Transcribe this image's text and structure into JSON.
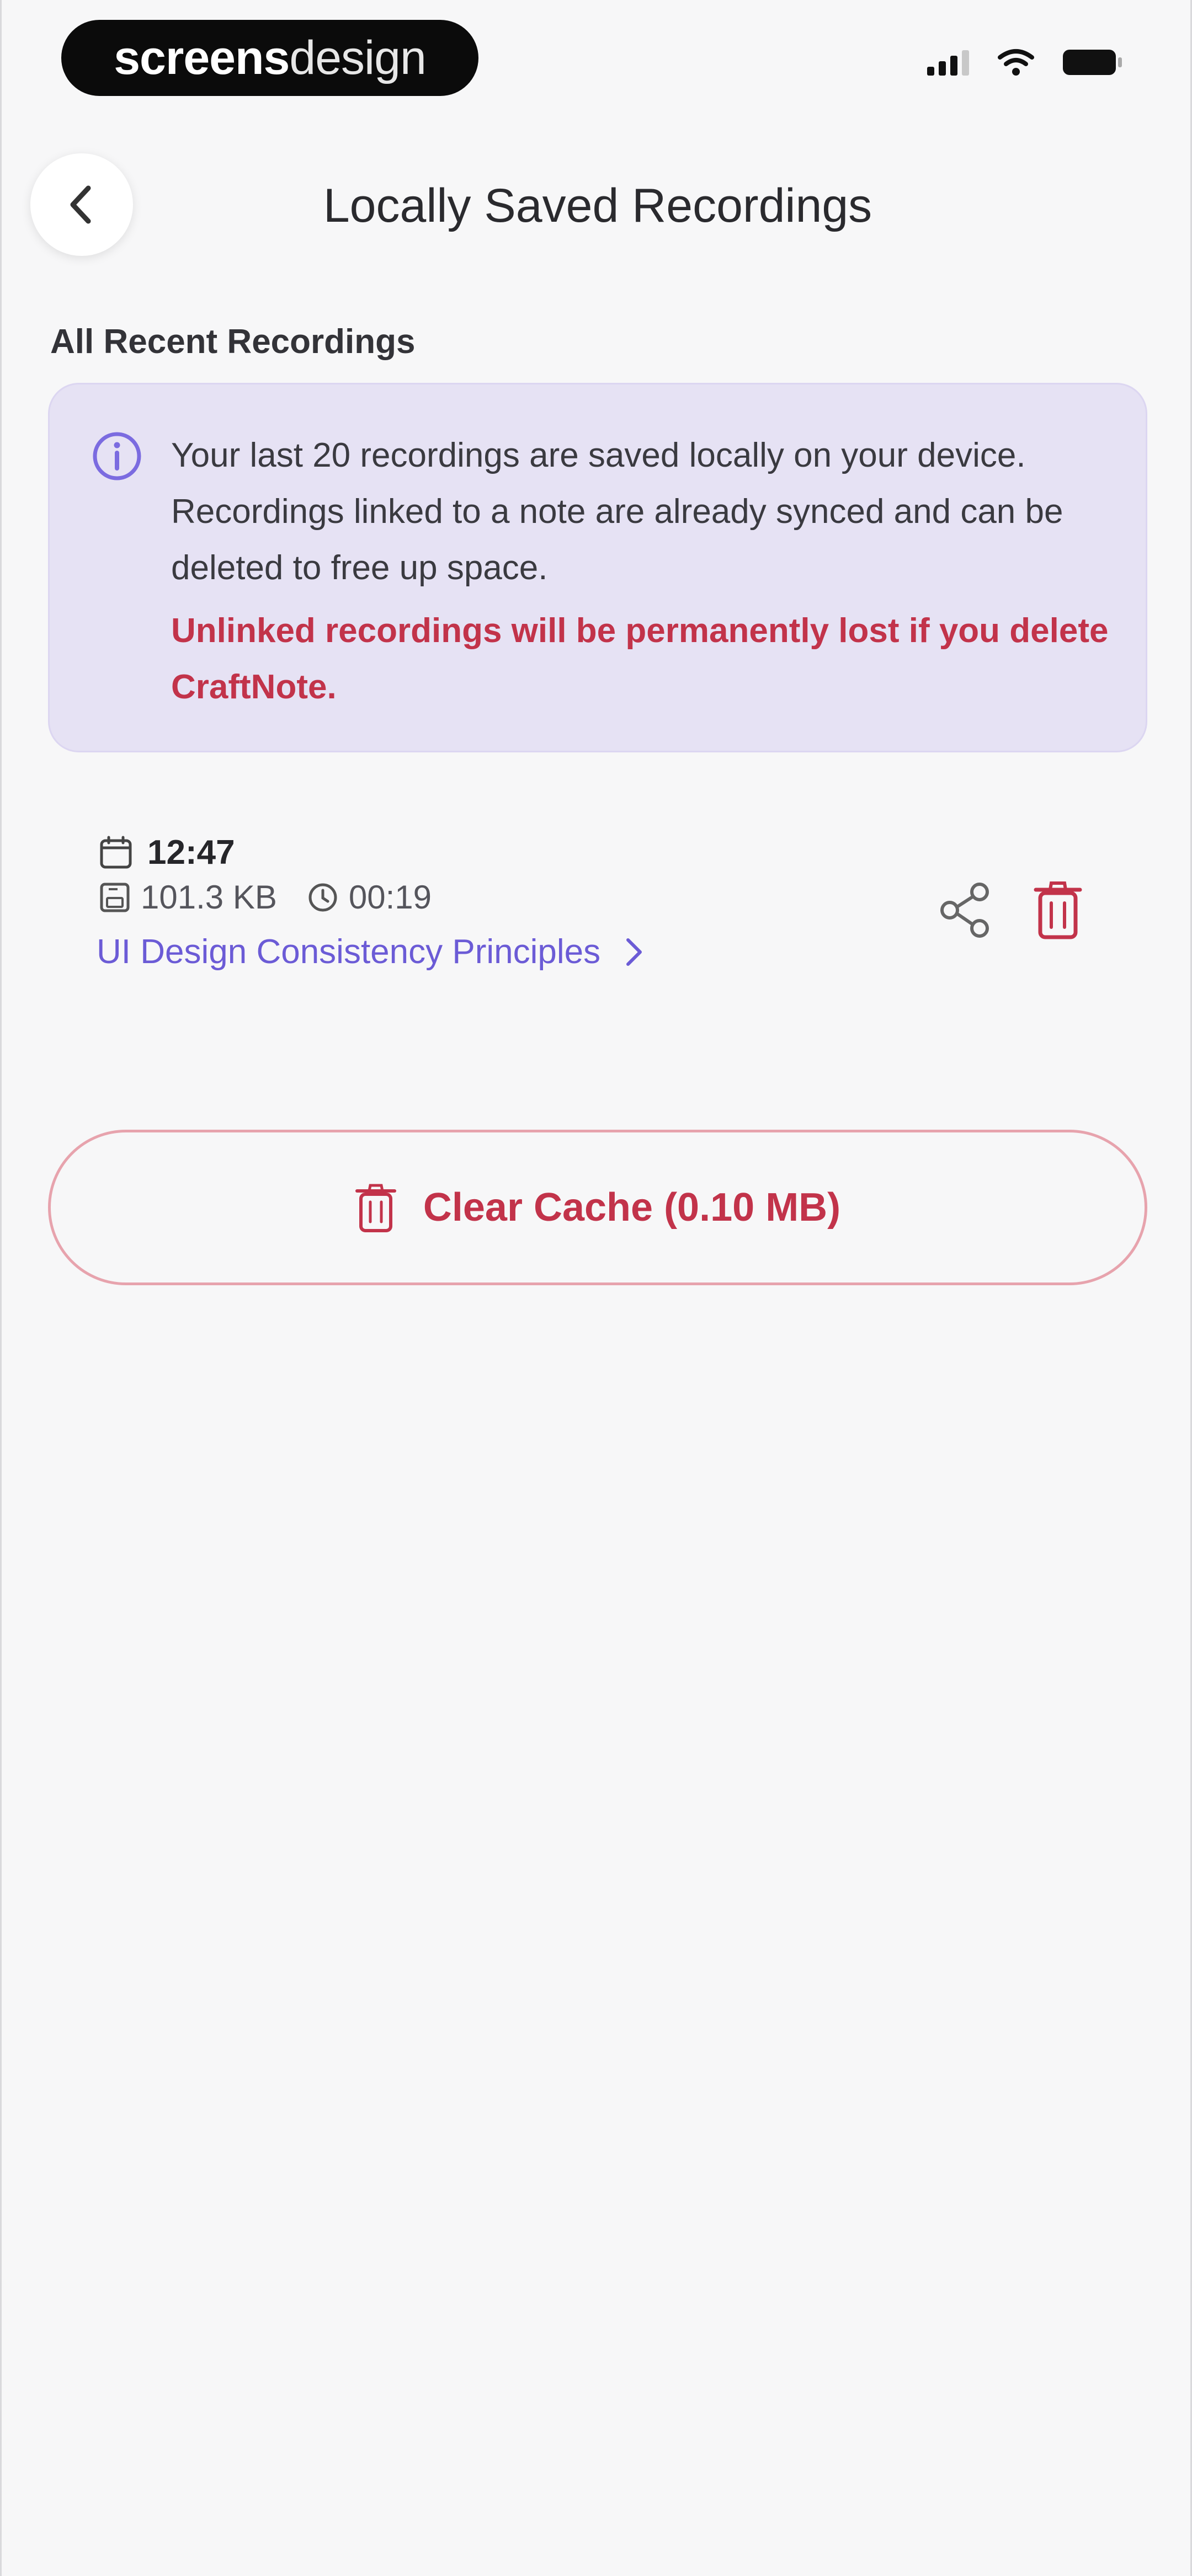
{
  "status_bar": {
    "brand_part1": "screens",
    "brand_part2": "design"
  },
  "header": {
    "title": "Locally Saved Recordings",
    "back_icon": "chevron-left-icon"
  },
  "section": {
    "label": "All Recent Recordings"
  },
  "info_card": {
    "icon": "info-icon",
    "message": "Your last 20 recordings are saved locally on your device. Recordings linked to a note are already synced and can be deleted to free up space.",
    "warning": "Unlinked recordings will be permanently lost if you delete CraftNote."
  },
  "recordings": [
    {
      "time": "12:47",
      "size": "101.3 KB",
      "duration": "00:19",
      "linked_note": "UI Design Consistency Principles"
    }
  ],
  "clear_cache": {
    "label": "Clear Cache (0.10 MB)"
  },
  "colors": {
    "accent_purple": "#6b5bd6",
    "danger_red": "#c2334a",
    "info_bg": "#e6e2f4",
    "background": "#f7f7f8"
  }
}
